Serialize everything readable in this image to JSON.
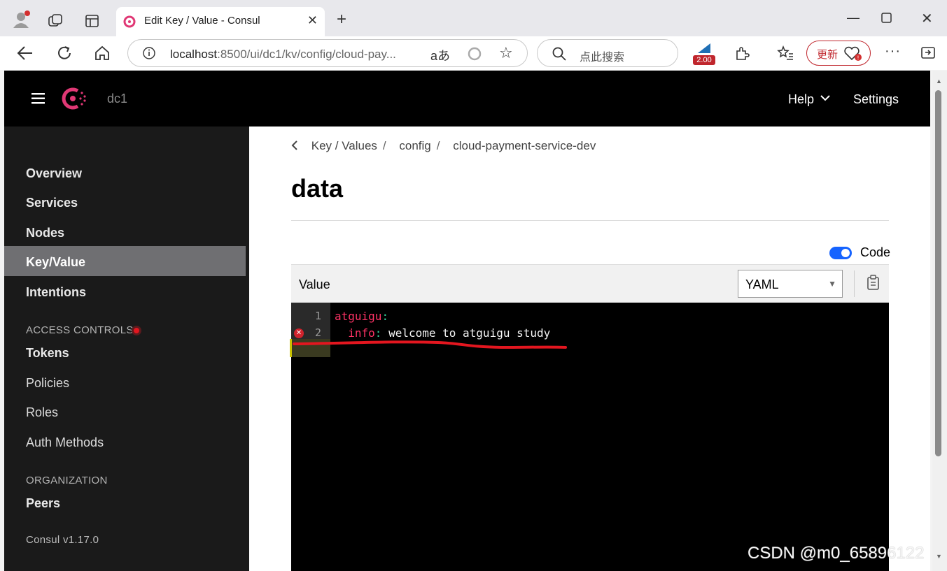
{
  "browser": {
    "tab_title": "Edit Key / Value - Consul",
    "url_host": "localhost",
    "url_path": ":8500/ui/dc1/kv/config/cloud-pay...",
    "search_placeholder": "点此搜索",
    "extension_badge": "2.00",
    "update_label": "更新"
  },
  "consul": {
    "datacenter": "dc1",
    "top_nav": {
      "help": "Help",
      "settings": "Settings"
    },
    "sidebar": {
      "items": [
        "Overview",
        "Services",
        "Nodes",
        "Key/Value",
        "Intentions"
      ],
      "active": "Key/Value",
      "access_controls_heading": "ACCESS CONTROLS",
      "access_items": [
        "Tokens",
        "Policies",
        "Roles",
        "Auth Methods"
      ],
      "organization_heading": "ORGANIZATION",
      "org_items": [
        "Peers"
      ],
      "version": "Consul v1.17.0"
    },
    "breadcrumb": [
      "Key / Values",
      "config",
      "cloud-payment-service-dev"
    ],
    "page_title": "data",
    "code_toggle_label": "Code",
    "value_label": "Value",
    "mode_select": "YAML",
    "editor": {
      "line_numbers": [
        "1",
        "2"
      ],
      "line1_key": "atguigu",
      "line1_colon": ":",
      "line2_indent": "  ",
      "line2_key": "info",
      "line2_colon": ":",
      "line2_value": " welcome to atguigu study"
    }
  },
  "watermark": "CSDN @m0_65896122",
  "colors": {
    "consul_brand": "#e03875",
    "toggle_on": "#1563ff",
    "annotation_red": "#e3161f"
  }
}
